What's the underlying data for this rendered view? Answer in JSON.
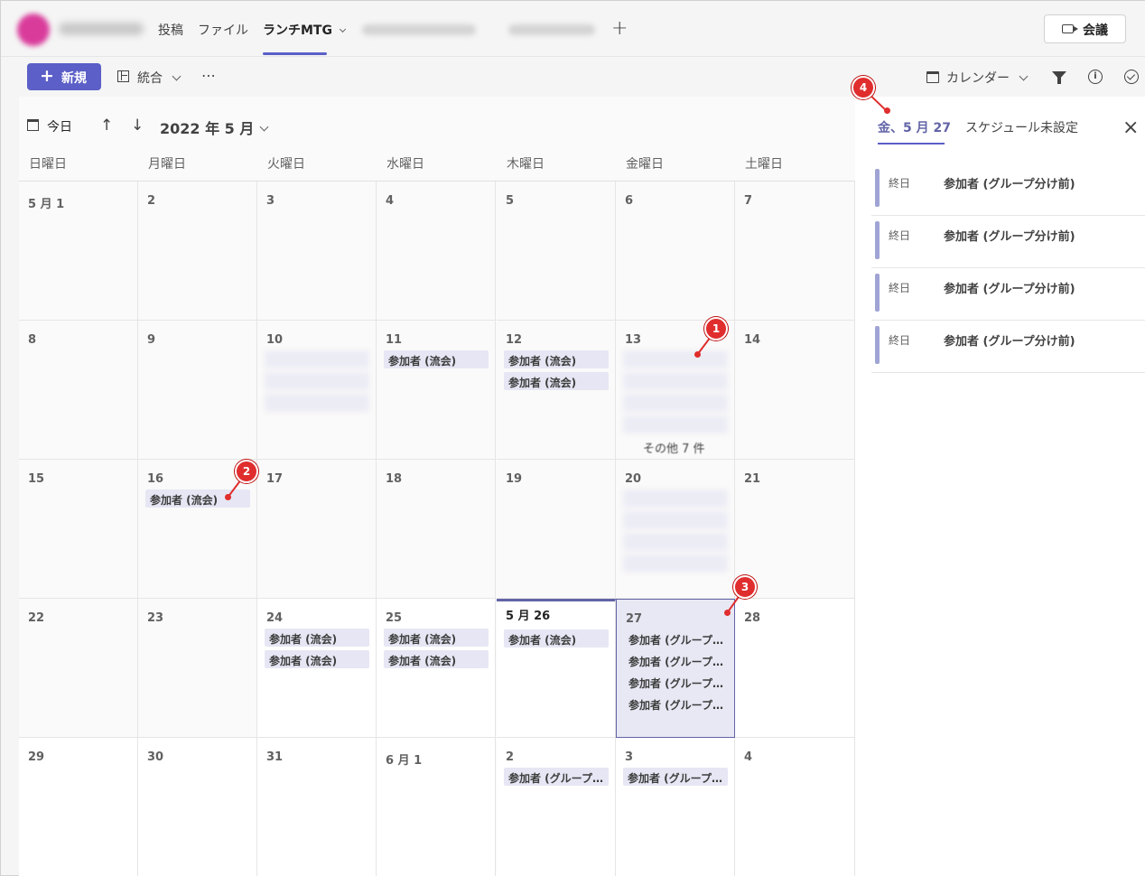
{
  "header": {
    "tabs": [
      {
        "label": "投稿"
      },
      {
        "label": "ファイル"
      },
      {
        "label": "ランチMTG"
      }
    ],
    "add_tab": "+",
    "meet_button": "会議"
  },
  "toolbar": {
    "new_button": "新規",
    "merge": "統合",
    "more": "⋯",
    "view": "カレンダー"
  },
  "calendar": {
    "today": "今日",
    "month": "2022 年 5 月",
    "weekdays": [
      "日曜日",
      "月曜日",
      "火曜日",
      "水曜日",
      "木曜日",
      "金曜日",
      "土曜日"
    ],
    "weeks": [
      [
        {
          "day": "5 月 1",
          "events": []
        },
        {
          "day": "2",
          "events": []
        },
        {
          "day": "3",
          "events": []
        },
        {
          "day": "4",
          "events": []
        },
        {
          "day": "5",
          "events": []
        },
        {
          "day": "6",
          "events": []
        },
        {
          "day": "7",
          "events": []
        }
      ],
      [
        {
          "day": "8",
          "events": []
        },
        {
          "day": "9",
          "events": []
        },
        {
          "day": "10",
          "blurred": 3,
          "events": []
        },
        {
          "day": "11",
          "events": [
            "参加者 (流会)"
          ]
        },
        {
          "day": "12",
          "events": [
            "参加者 (流会)",
            "参加者 (流会)"
          ]
        },
        {
          "day": "13",
          "blurred": 4,
          "more": "その他 7 件",
          "events": []
        },
        {
          "day": "14",
          "events": []
        }
      ],
      [
        {
          "day": "15",
          "events": []
        },
        {
          "day": "16",
          "events": [
            "参加者 (流会)"
          ]
        },
        {
          "day": "17",
          "events": []
        },
        {
          "day": "18",
          "events": []
        },
        {
          "day": "19",
          "events": []
        },
        {
          "day": "20",
          "blurred": 4,
          "events": []
        },
        {
          "day": "21",
          "events": []
        }
      ],
      [
        {
          "day": "22",
          "events": []
        },
        {
          "day": "23",
          "events": []
        },
        {
          "day": "24",
          "events": [
            "参加者 (流会)",
            "参加者 (流会)"
          ]
        },
        {
          "day": "25",
          "events": [
            "参加者 (流会)",
            "参加者 (流会)"
          ]
        },
        {
          "day": "5 月 26",
          "today": true,
          "events": [
            "参加者 (流会)"
          ]
        },
        {
          "day": "27",
          "selected": true,
          "events": [
            "参加者 (グループ分け前)",
            "参加者 (グループ分け前)",
            "参加者 (グループ分け前)",
            "参加者 (グループ分け前)"
          ]
        },
        {
          "day": "28",
          "events": []
        }
      ],
      [
        {
          "day": "29",
          "events": []
        },
        {
          "day": "30",
          "events": []
        },
        {
          "day": "31",
          "events": []
        },
        {
          "day": "6 月 1",
          "events": []
        },
        {
          "day": "2",
          "events": [
            "参加者 (グループ分け前)"
          ]
        },
        {
          "day": "3",
          "events": [
            "参加者 (グループ分け前)"
          ]
        },
        {
          "day": "4",
          "events": []
        }
      ]
    ]
  },
  "side_panel": {
    "tab_date": "金、5 月 27",
    "tab_unscheduled": "スケジュール未設定",
    "close": "×",
    "items": [
      {
        "time": "終日",
        "title": "参加者 (グループ分け前)"
      },
      {
        "time": "終日",
        "title": "参加者 (グループ分け前)"
      },
      {
        "time": "終日",
        "title": "参加者 (グループ分け前)"
      },
      {
        "time": "終日",
        "title": "参加者 (グループ分け前)"
      }
    ]
  },
  "annotations": [
    "1",
    "2",
    "3",
    "4"
  ],
  "icons": {
    "today": "calendar-today-icon",
    "up": "arrow-up-icon",
    "down": "arrow-down-icon",
    "merge": "grid-icon",
    "view": "calendar-icon",
    "filter": "filter-icon",
    "info": "info-icon",
    "check": "check-circle-icon",
    "meet": "video-camera-icon"
  },
  "colors": {
    "accent": "#5b5fc7",
    "event_bg": "#e6e6f4",
    "marker": "#e02d2d"
  }
}
